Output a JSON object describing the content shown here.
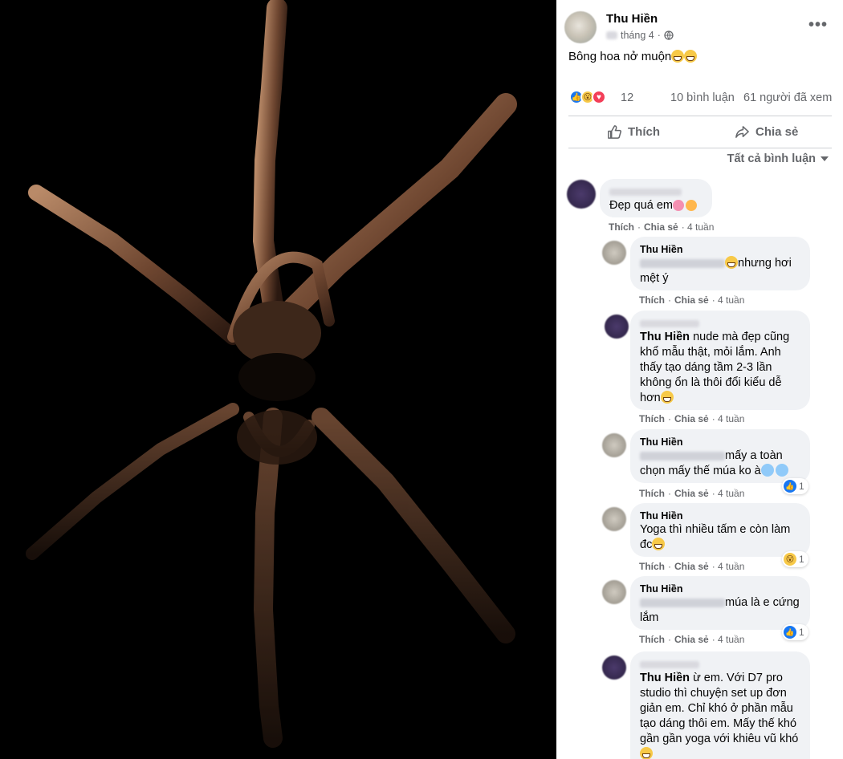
{
  "post": {
    "author": "Thu Hiền",
    "date_suffix": "tháng 4",
    "caption": "Bông hoa nở muộn",
    "reaction_count": "12",
    "comments_count": "10 bình luận",
    "views_count": "61 người đã xem"
  },
  "actions": {
    "like": "Thích",
    "share": "Chia sẻ"
  },
  "filter_label": "Tất cả bình luận",
  "comment_actions": {
    "like": "Thích",
    "share": "Chia sẻ"
  },
  "comments": [
    {
      "name": "",
      "text": "Đẹp quá em",
      "time": "4 tuần"
    },
    {
      "name": "Thu Hiền",
      "text": "nhưng hơi mệt ý",
      "time": "4 tuần"
    },
    {
      "name": "",
      "mention": "Thu Hiền",
      "text": "nude mà đẹp cũng khổ mẫu thật, mỏi lắm. Anh thấy tạo dáng tầm 2-3 lần không ổn là thôi đổi kiểu dễ hơn",
      "time": "4 tuần"
    },
    {
      "name": "Thu Hiền",
      "text": "mấy a toàn chọn mấy thế múa ko à",
      "time": "4 tuần",
      "reactions": "1"
    },
    {
      "name": "Thu Hiền",
      "text": "Yoga thì nhiều tấm e còn làm đc",
      "time": "4 tuần",
      "reactions": "1"
    },
    {
      "name": "Thu Hiền",
      "text": "múa là e cứng lắm",
      "time": "4 tuần",
      "reactions": "1"
    },
    {
      "name": "",
      "mention": "Thu Hiền",
      "text": "ừ em. Với D7 pro studio thì chuyện set up đơn giản em. Chỉ khó ở phần mẫu tạo dáng thôi em. Mấy thế khó gần gần yoga với khiêu vũ khó",
      "time": ""
    }
  ],
  "colors": {
    "accent": "#1877f2",
    "muted": "#65676b",
    "bubble": "#f0f2f5"
  },
  "icons": [
    "globe-icon",
    "more-icon",
    "like-icon",
    "share-icon",
    "chevron-down-icon"
  ]
}
